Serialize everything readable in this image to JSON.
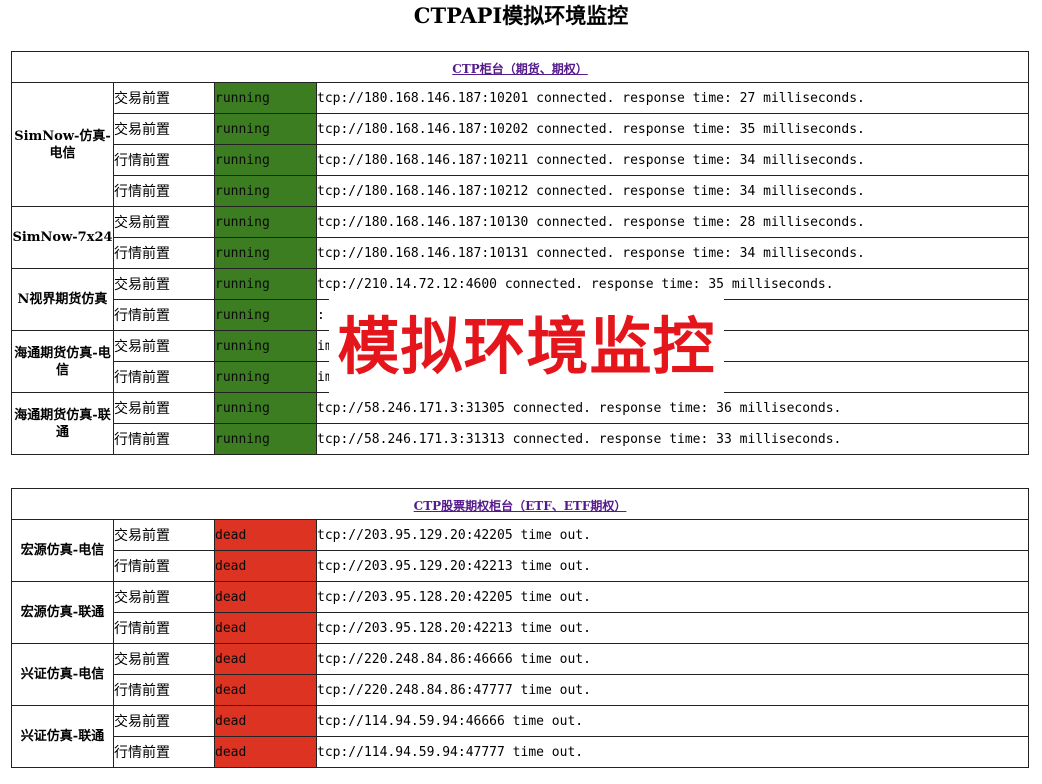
{
  "page": {
    "title": "CTPAPI模拟环境监控"
  },
  "colors": {
    "running": "#3c7d22",
    "dead": "#dd3322",
    "link": "#551a8b",
    "watermark": "#e5151c"
  },
  "tables": [
    {
      "caption": "CTP柜台（期货、期权）",
      "groups": [
        {
          "name": "SimNow-仿真-电信",
          "rows": [
            {
              "type": "交易前置",
              "status": "running",
              "message": "tcp://180.168.146.187:10201 connected. response time: 27 milliseconds."
            },
            {
              "type": "交易前置",
              "status": "running",
              "message": "tcp://180.168.146.187:10202 connected. response time: 35 milliseconds."
            },
            {
              "type": "行情前置",
              "status": "running",
              "message": "tcp://180.168.146.187:10211 connected. response time: 34 milliseconds."
            },
            {
              "type": "行情前置",
              "status": "running",
              "message": "tcp://180.168.146.187:10212 connected. response time: 34 milliseconds."
            }
          ]
        },
        {
          "name": "SimNow-7x24",
          "rows": [
            {
              "type": "交易前置",
              "status": "running",
              "message": "tcp://180.168.146.187:10130 connected. response time: 28 milliseconds."
            },
            {
              "type": "行情前置",
              "status": "running",
              "message": "tcp://180.168.146.187:10131 connected. response time: 34 milliseconds."
            }
          ]
        },
        {
          "name": "N视界期货仿真",
          "rows": [
            {
              "type": "交易前置",
              "status": "running",
              "message": "tcp://210.14.72.12:4600 connected. response time: 35 milliseconds."
            },
            {
              "type": "行情前置",
              "status": "running",
              "message": ": 32 milliseconds."
            }
          ]
        },
        {
          "name": "海通期货仿真-电信",
          "rows": [
            {
              "type": "交易前置",
              "status": "running",
              "message": "ime: 29 milliseconds."
            },
            {
              "type": "行情前置",
              "status": "running",
              "message": "ime: 34 milliseconds."
            }
          ]
        },
        {
          "name": "海通期货仿真-联通",
          "rows": [
            {
              "type": "交易前置",
              "status": "running",
              "message": "tcp://58.246.171.3:31305 connected. response time: 36 milliseconds."
            },
            {
              "type": "行情前置",
              "status": "running",
              "message": "tcp://58.246.171.3:31313 connected. response time: 33 milliseconds."
            }
          ]
        }
      ]
    },
    {
      "caption": "CTP股票期权柜台（ETF、ETF期权）",
      "groups": [
        {
          "name": "宏源仿真-电信",
          "rows": [
            {
              "type": "交易前置",
              "status": "dead",
              "message": "tcp://203.95.129.20:42205 time out."
            },
            {
              "type": "行情前置",
              "status": "dead",
              "message": "tcp://203.95.129.20:42213 time out."
            }
          ]
        },
        {
          "name": "宏源仿真-联通",
          "rows": [
            {
              "type": "交易前置",
              "status": "dead",
              "message": "tcp://203.95.128.20:42205 time out."
            },
            {
              "type": "行情前置",
              "status": "dead",
              "message": "tcp://203.95.128.20:42213 time out."
            }
          ]
        },
        {
          "name": "兴证仿真-电信",
          "rows": [
            {
              "type": "交易前置",
              "status": "dead",
              "message": "tcp://220.248.84.86:46666 time out."
            },
            {
              "type": "行情前置",
              "status": "dead",
              "message": "tcp://220.248.84.86:47777 time out."
            }
          ]
        },
        {
          "name": "兴证仿真-联通",
          "rows": [
            {
              "type": "交易前置",
              "status": "dead",
              "message": "tcp://114.94.59.94:46666 time out."
            },
            {
              "type": "行情前置",
              "status": "dead",
              "message": "tcp://114.94.59.94:47777 time out."
            }
          ]
        }
      ]
    }
  ],
  "overlay": {
    "watermark_text": "模拟环境监控"
  }
}
